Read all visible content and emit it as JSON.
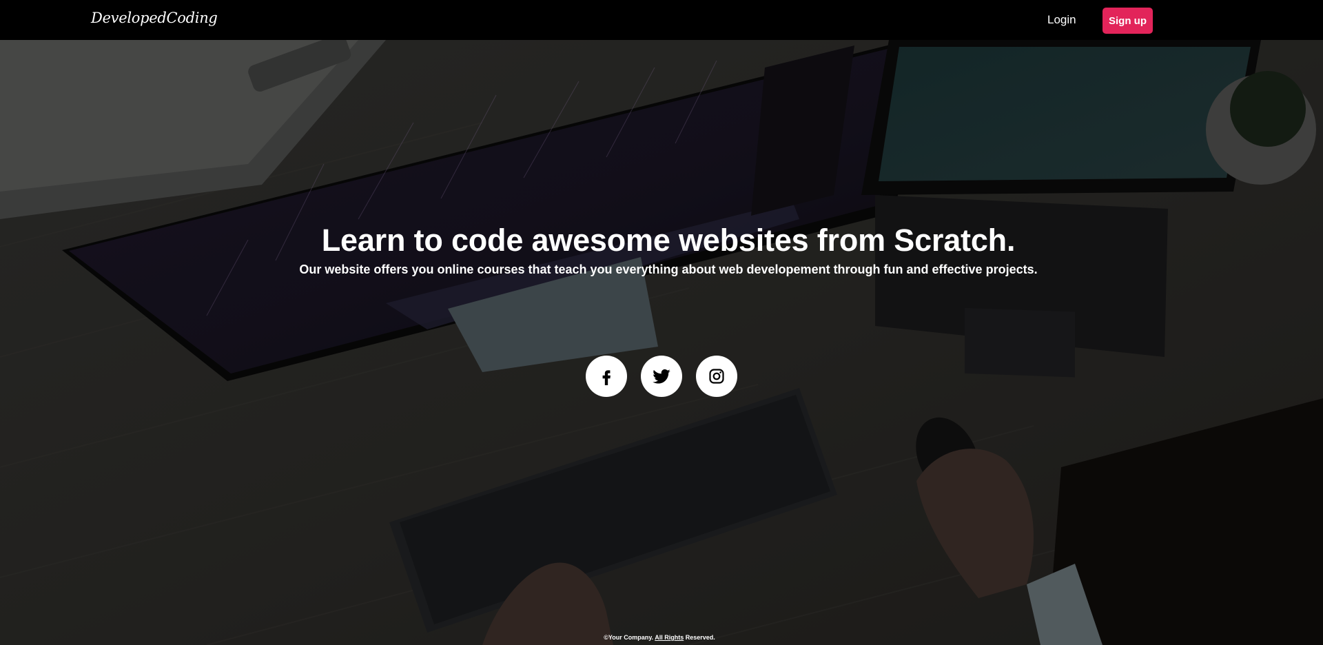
{
  "header": {
    "logo": "DevelopedCoding",
    "login_label": "Login",
    "signup_label": "Sign up",
    "signup_color": "#e2245a"
  },
  "hero": {
    "title": "Learn to code awesome websites from Scratch.",
    "subtitle": "Our website offers you online courses that teach you everything about web developement through fun and effective projects.",
    "background_image": "desk-workspace-photo",
    "socials": [
      {
        "name": "facebook",
        "icon": "facebook-icon"
      },
      {
        "name": "twitter",
        "icon": "twitter-icon"
      },
      {
        "name": "instagram",
        "icon": "instagram-icon"
      }
    ]
  },
  "footer": {
    "prefix": "©Your Company. ",
    "link": "All Rights",
    "suffix": " Reserved."
  }
}
